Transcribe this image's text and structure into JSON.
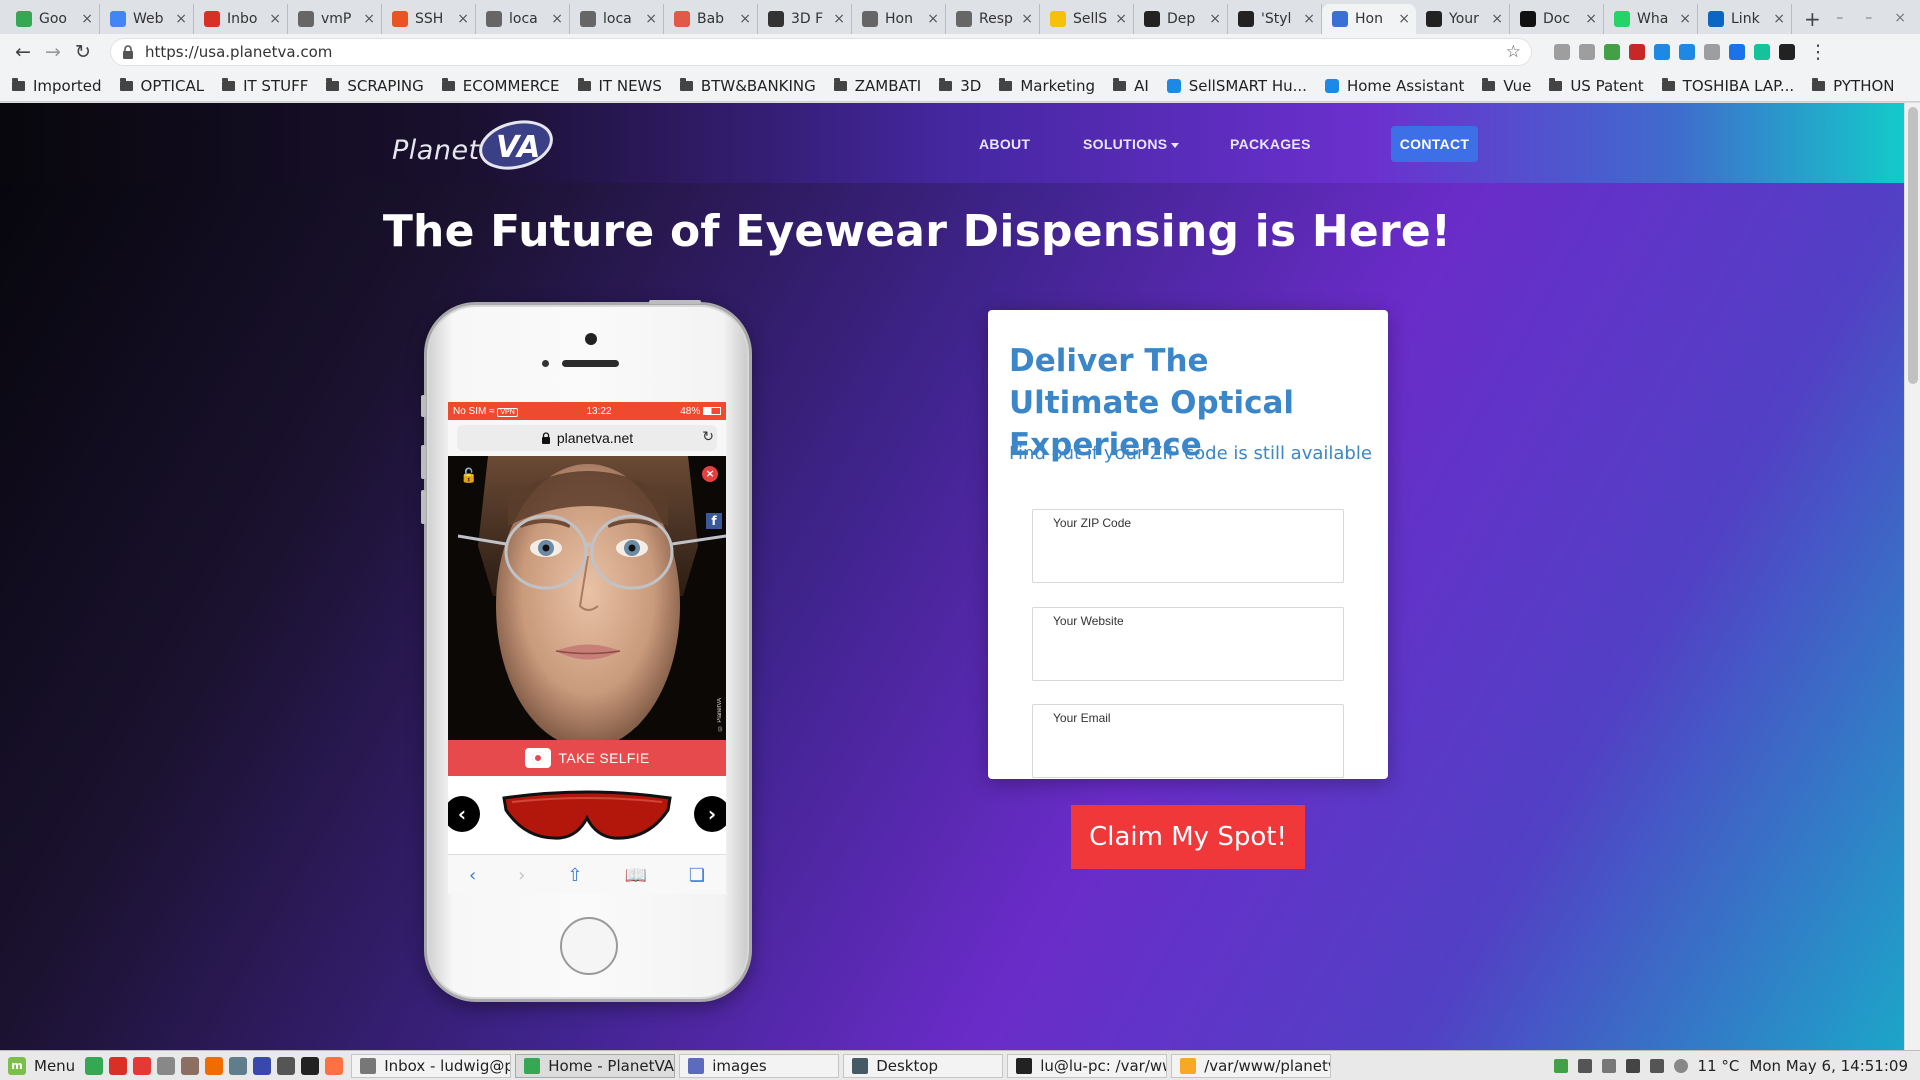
{
  "browser": {
    "tabs": [
      {
        "label": "Goo",
        "color": "#34a853",
        "icon": "google-icon"
      },
      {
        "label": "Web",
        "color": "#4285f4",
        "icon": "web-icon"
      },
      {
        "label": "Inbo",
        "color": "#d93025",
        "icon": "gmail-icon"
      },
      {
        "label": "vmP",
        "color": "#666666",
        "icon": "globe-icon"
      },
      {
        "label": "SSH",
        "color": "#e95420",
        "icon": "ubuntu-icon"
      },
      {
        "label": "loca",
        "color": "#666666",
        "icon": "globe-icon"
      },
      {
        "label": "loca",
        "color": "#666666",
        "icon": "globe-icon"
      },
      {
        "label": "Bab",
        "color": "#e05a47",
        "icon": "babylon-icon"
      },
      {
        "label": "3D F",
        "color": "#333333",
        "icon": "3d-icon"
      },
      {
        "label": "Hon",
        "color": "#666666",
        "icon": "globe-icon"
      },
      {
        "label": "Resp",
        "color": "#666666",
        "icon": "globe-icon"
      },
      {
        "label": "SellS",
        "color": "#f4c20d",
        "icon": "sellsmart-icon"
      },
      {
        "label": "Dep",
        "color": "#222222",
        "icon": "github-icon"
      },
      {
        "label": "'Styl",
        "color": "#222222",
        "icon": "style-icon"
      },
      {
        "label": "Hon",
        "color": "#3a6fd8",
        "icon": "planetva-icon",
        "active": true
      },
      {
        "label": "Your",
        "color": "#222222",
        "icon": "github-icon"
      },
      {
        "label": "Doc",
        "color": "#111111",
        "icon": "dev-icon"
      },
      {
        "label": "Wha",
        "color": "#25d366",
        "icon": "whatsapp-icon"
      },
      {
        "label": "Link",
        "color": "#0a66c2",
        "icon": "linkedin-icon"
      }
    ],
    "url": "https://usa.planetva.com",
    "extension_colors": [
      "#9e9e9e",
      "#9e9e9e",
      "#43a047",
      "#c62828",
      "#1e88e5",
      "#1e88e5",
      "#9e9e9e",
      "#1a73e8",
      "#15c39a",
      "#222222"
    ],
    "bookmarks": [
      {
        "label": "Imported",
        "type": "folder"
      },
      {
        "label": "OPTICAL",
        "type": "folder"
      },
      {
        "label": "IT STUFF",
        "type": "folder"
      },
      {
        "label": "SCRAPING",
        "type": "folder"
      },
      {
        "label": "ECOMMERCE",
        "type": "folder"
      },
      {
        "label": "IT NEWS",
        "type": "folder"
      },
      {
        "label": "BTW&BANKING",
        "type": "folder"
      },
      {
        "label": "ZAMBATI",
        "type": "folder"
      },
      {
        "label": "3D",
        "type": "folder"
      },
      {
        "label": "Marketing",
        "type": "folder"
      },
      {
        "label": "AI",
        "type": "folder"
      },
      {
        "label": "SellSMART Hu...",
        "type": "link"
      },
      {
        "label": "Home Assistant",
        "type": "link"
      },
      {
        "label": "Vue",
        "type": "folder"
      },
      {
        "label": "US Patent",
        "type": "folder"
      },
      {
        "label": "TOSHIBA LAP...",
        "type": "folder"
      },
      {
        "label": "PYTHON",
        "type": "folder"
      }
    ]
  },
  "site": {
    "logo_planet": "Planet",
    "logo_va": "VA",
    "nav": {
      "about": "ABOUT",
      "solutions": "SOLUTIONS",
      "packages": "PACKAGES",
      "contact": "CONTACT"
    },
    "headline": "The Future of Eyewear Dispensing is Here!",
    "phone": {
      "carrier": "No SIM",
      "vpn": "VPN",
      "time": "13:22",
      "battery": "48%",
      "domain": "planetva.net",
      "watermark": "© PlanetVA",
      "selfie_label": "TAKE SELFIE"
    },
    "form": {
      "title": "Deliver The Ultimate Optical Experience",
      "subtitle": "Find out if your ZIP code is still available",
      "zip_label": "Your ZIP Code",
      "zip_value": "",
      "website_label": "Your Website",
      "website_value": "",
      "email_label": "Your Email",
      "email_value": "",
      "submit_label": "Claim My Spot!"
    },
    "colors": {
      "accent_blue": "#3a86c8",
      "cta_red": "#f0373a",
      "contact_blue": "#3d6fe6"
    }
  },
  "taskbar": {
    "menu_label": "Menu",
    "launcher_colors": [
      "#34a853",
      "#d93025",
      "#e53935",
      "#888888",
      "#8d6e63",
      "#ef6c00",
      "#607d8b",
      "#3949ab",
      "#555555",
      "#222222",
      "#ff7043"
    ],
    "tasks": [
      {
        "label": "Inbox - ludwig@plan...",
        "color": "#777777"
      },
      {
        "label": "Home - PlanetVA - Go...",
        "color": "#34a853",
        "active": true
      },
      {
        "label": "images",
        "color": "#5c6bc0"
      },
      {
        "label": "Desktop",
        "color": "#455a64"
      },
      {
        "label": "lu@lu-pc: /var/www/...",
        "color": "#222222"
      },
      {
        "label": "/var/www/planetva-u...",
        "color": "#f9a825"
      }
    ],
    "temperature": "11 °C",
    "clock": "Mon May 6, 14:51:09"
  }
}
